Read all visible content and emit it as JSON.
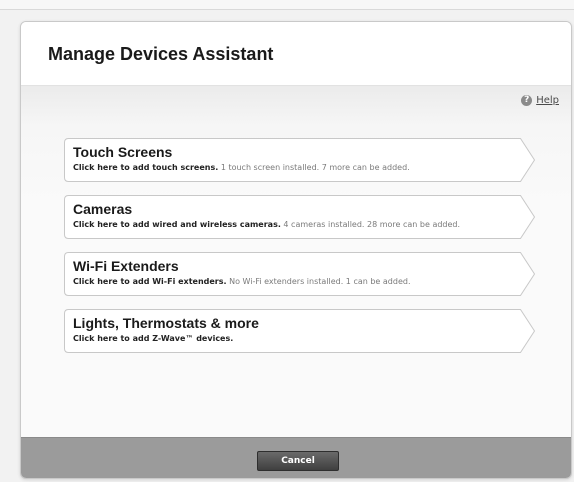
{
  "dialog": {
    "title": "Manage Devices Assistant",
    "help_label": "Help",
    "help_icon": "question-icon",
    "cancel_label": "Cancel"
  },
  "options": [
    {
      "title": "Touch Screens",
      "action": "Click here to add touch screens.",
      "status": "1 touch screen installed. 7 more can be added."
    },
    {
      "title": "Cameras",
      "action": "Click here to add wired and wireless cameras.",
      "status": "4 cameras installed. 28 more can be added."
    },
    {
      "title": "Wi-Fi Extenders",
      "action": "Click here to add Wi-Fi extenders.",
      "status": "No Wi-Fi extenders installed. 1 can be added."
    },
    {
      "title": "Lights, Thermostats & more",
      "action": "Click here to add Z-Wave™ devices.",
      "status": ""
    }
  ],
  "colors": {
    "footer": "#9b9b9b",
    "button": "#4a4a4a",
    "status_text": "#7a7a7a"
  }
}
